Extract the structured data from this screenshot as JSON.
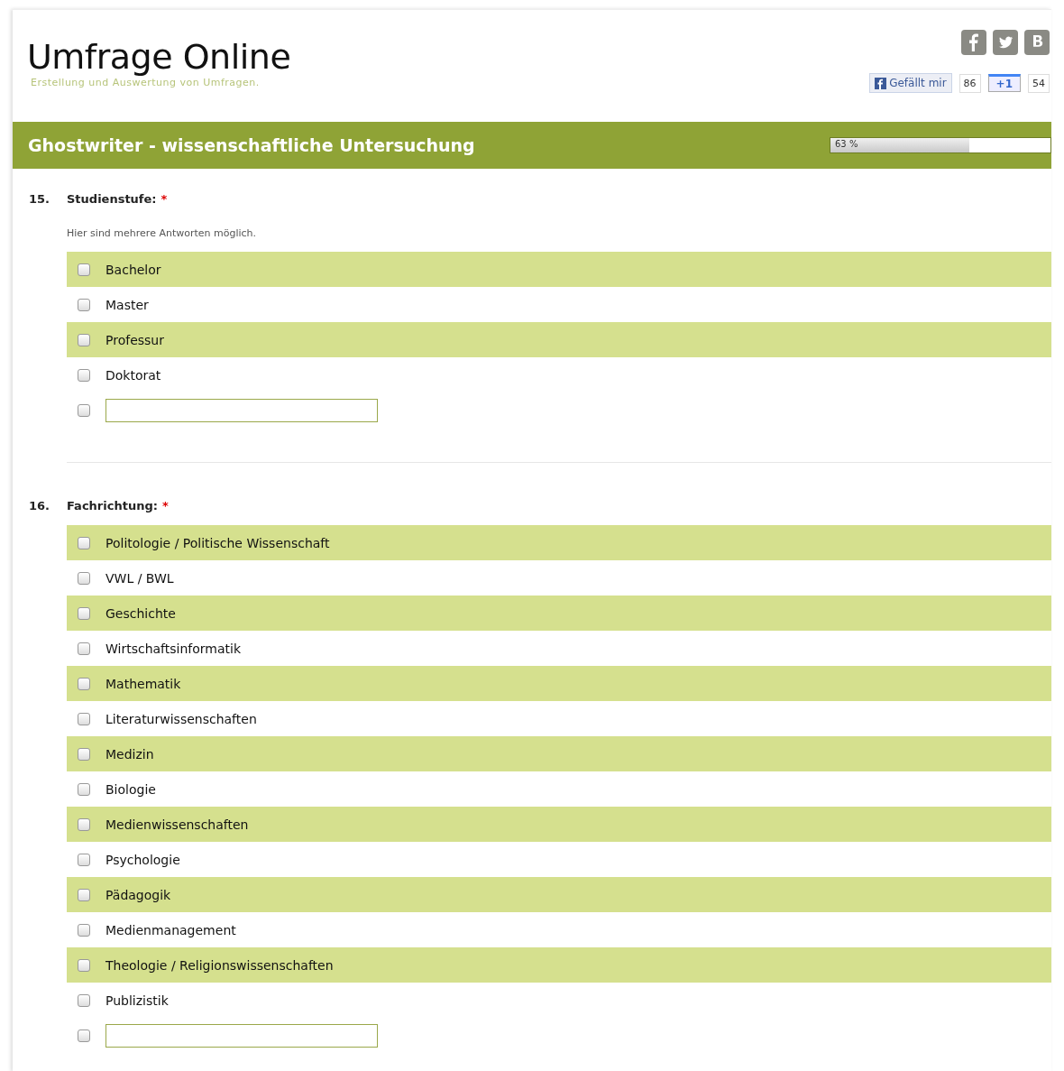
{
  "header": {
    "title": "Umfrage Online",
    "subtitle": "Erstellung und Auswertung von Umfragen.",
    "like_button": "Gefällt mir",
    "like_count": "86",
    "plusone_button": "+1",
    "plusone_count": "54",
    "share_icons": [
      {
        "kind": "facebook"
      },
      {
        "kind": "twitter"
      },
      {
        "kind": "blogger"
      }
    ]
  },
  "survey": {
    "title": "Ghostwriter - wissenschaftliche Untersuchung",
    "progress": {
      "level": 0.63,
      "reading": "63 %"
    }
  },
  "questions": [
    {
      "number": "15.",
      "title": "Studienstufe:",
      "required_mark": "*",
      "hint": "Hier sind mehrere Antworten möglich.",
      "options": [
        {
          "kind": "label",
          "label": "Bachelor",
          "checked": false
        },
        {
          "kind": "label",
          "label": "Master",
          "checked": false
        },
        {
          "kind": "label",
          "label": "Professur",
          "checked": false
        },
        {
          "kind": "label",
          "label": "Doktorat",
          "checked": false
        },
        {
          "kind": "input",
          "checked": false
        }
      ]
    },
    {
      "number": "16.",
      "title": "Fachrichtung:",
      "required_mark": "*",
      "options": [
        {
          "kind": "label",
          "label": "Politologie / Politische Wissenschaft",
          "checked": false
        },
        {
          "kind": "label",
          "label": "VWL / BWL",
          "checked": false
        },
        {
          "kind": "label",
          "label": "Geschichte",
          "checked": false
        },
        {
          "kind": "label",
          "label": "Wirtschaftsinformatik",
          "checked": false
        },
        {
          "kind": "label",
          "label": "Mathematik",
          "checked": false
        },
        {
          "kind": "label",
          "label": "Literaturwissenschaften",
          "checked": false
        },
        {
          "kind": "label",
          "label": "Medizin",
          "checked": false
        },
        {
          "kind": "label",
          "label": "Biologie",
          "checked": false
        },
        {
          "kind": "label",
          "label": "Medienwissenschaften",
          "checked": false
        },
        {
          "kind": "label",
          "label": "Psychologie",
          "checked": false
        },
        {
          "kind": "label",
          "label": "Pädagogik",
          "checked": false
        },
        {
          "kind": "label",
          "label": "Medienmanagement",
          "checked": false
        },
        {
          "kind": "label",
          "label": "Theologie / Religionswissenschaften",
          "checked": false
        },
        {
          "kind": "label",
          "label": "Publizistik",
          "checked": false
        },
        {
          "kind": "input",
          "checked": false
        }
      ]
    }
  ]
}
